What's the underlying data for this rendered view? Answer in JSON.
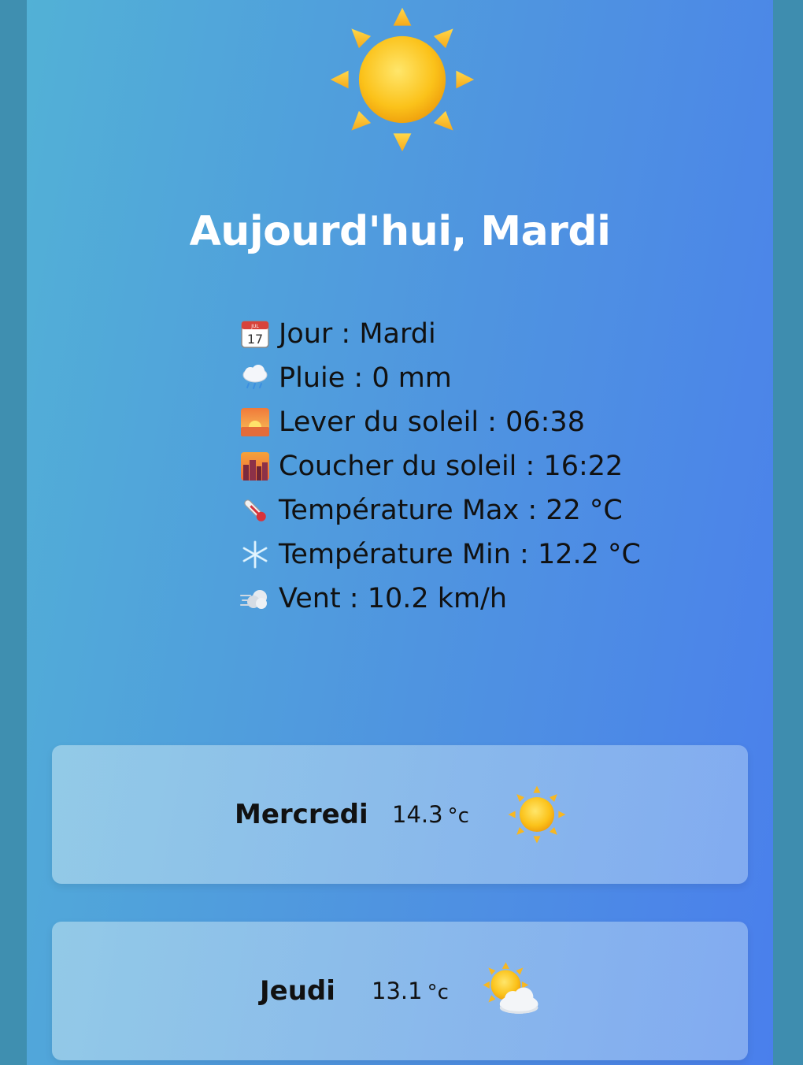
{
  "today": {
    "title": "Aujourd'hui, Mardi",
    "icon": "sun-icon",
    "details": [
      {
        "icon": "calendar-icon",
        "label": "Jour : Mardi"
      },
      {
        "icon": "rain-cloud-icon",
        "label": "Pluie : 0 mm"
      },
      {
        "icon": "sunrise-icon",
        "label": "Lever du soleil : 06:38"
      },
      {
        "icon": "sunset-city-icon",
        "label": "Coucher du soleil : 16:22"
      },
      {
        "icon": "thermometer-icon",
        "label": "Température Max : 22 °C"
      },
      {
        "icon": "snowflake-icon",
        "label": "Température Min : 12.2 °C"
      },
      {
        "icon": "wind-icon",
        "label": "Vent : 10.2 km/h"
      }
    ]
  },
  "forecast": [
    {
      "day": "Mercredi",
      "temp": "14.3",
      "unit": "°c",
      "icon": "sun-icon"
    },
    {
      "day": "Jeudi",
      "temp": "13.1",
      "unit": "°c",
      "icon": "sun-behind-cloud-icon"
    }
  ],
  "colors": {
    "background": "#3f8faf",
    "gradient_start": "#52b1d6",
    "gradient_end": "#4a7fec",
    "title_text": "#ffffff"
  }
}
